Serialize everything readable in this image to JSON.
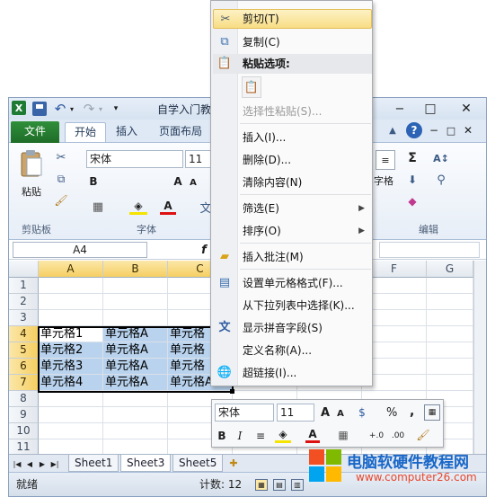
{
  "window": {
    "title": "自学入门教",
    "controls": {
      "minimize": "−",
      "restore": "□",
      "close": "✕"
    },
    "qat": {
      "undo": "↶",
      "redo": "↷"
    }
  },
  "ribbon_tabs": {
    "file": "文件",
    "home": "开始",
    "insert": "插入",
    "page_layout": "页面布局"
  },
  "ribbon": {
    "paste_label": "粘贴",
    "font_name": "宋体",
    "font_size": "11",
    "wrap_label": "字格",
    "groups": {
      "clipboard": "剪贴板",
      "font": "字体",
      "editing": "编辑"
    }
  },
  "formula_bar": {
    "name_box": "A4",
    "fx": "f"
  },
  "sheet": {
    "columns": [
      "A",
      "B",
      "C",
      "",
      "",
      "F",
      "G"
    ],
    "rows": [
      "1",
      "2",
      "3",
      "4",
      "5",
      "6",
      "7",
      "8",
      "9",
      "10",
      "11"
    ],
    "cells": [
      [
        "单元格1",
        "单元格A",
        "单元格"
      ],
      [
        "单元格2",
        "单元格A",
        "单元格"
      ],
      [
        "单元格3",
        "单元格A",
        "单元格"
      ],
      [
        "单元格4",
        "单元格A",
        "单元格A"
      ]
    ]
  },
  "sheet_tabs": [
    "Sheet1",
    "Sheet3",
    "Sheet5"
  ],
  "status_bar": {
    "ready": "就绪",
    "count": "计数: 12"
  },
  "context_menu": {
    "items": [
      {
        "label": "剪切(T)",
        "state": "hot"
      },
      {
        "label": "复制(C)"
      },
      {
        "label": "粘贴选项:",
        "state": "header"
      },
      {
        "label": "选择性粘贴(S)...",
        "state": "disabled"
      },
      {
        "label": "插入(I)..."
      },
      {
        "label": "删除(D)..."
      },
      {
        "label": "清除内容(N)"
      },
      {
        "label": "筛选(E)",
        "submenu": true
      },
      {
        "label": "排序(O)",
        "submenu": true
      },
      {
        "label": "插入批注(M)"
      },
      {
        "label": "设置单元格格式(F)..."
      },
      {
        "label": "从下拉列表中选择(K)..."
      },
      {
        "label": "显示拼音字段(S)"
      },
      {
        "label": "定义名称(A)..."
      },
      {
        "label": "超链接(I)..."
      }
    ]
  },
  "mini_toolbar": {
    "font_name": "宋体",
    "font_size": "11",
    "percent": "%",
    "comma": ","
  },
  "watermark": {
    "title": "电脑软硬件教程网",
    "url": "www.computer26.com"
  },
  "colors": {
    "accent_green": "#1e6d28",
    "selection": "#b9d3ee",
    "header_hl": "#f6cf62",
    "menu_hot": "#f8dd85"
  }
}
